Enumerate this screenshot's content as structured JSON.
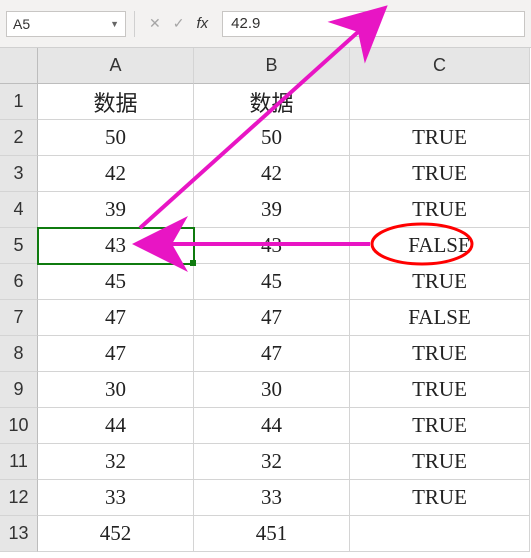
{
  "toolbar": {
    "name_box": "A5",
    "formula_value": "42.9"
  },
  "headers": {
    "col": [
      "A",
      "B",
      "C"
    ],
    "row": [
      "1",
      "2",
      "3",
      "4",
      "5",
      "6",
      "7",
      "8",
      "9",
      "10",
      "11",
      "12",
      "13"
    ]
  },
  "grid": {
    "r1": {
      "A": "数据",
      "B": "数据",
      "C": ""
    },
    "r2": {
      "A": "50",
      "B": "50",
      "C": "TRUE"
    },
    "r3": {
      "A": "42",
      "B": "42",
      "C": "TRUE"
    },
    "r4": {
      "A": "39",
      "B": "39",
      "C": "TRUE"
    },
    "r5": {
      "A": "43",
      "B": "43",
      "C": "FALSE"
    },
    "r6": {
      "A": "45",
      "B": "45",
      "C": "TRUE"
    },
    "r7": {
      "A": "47",
      "B": "47",
      "C": "FALSE"
    },
    "r8": {
      "A": "47",
      "B": "47",
      "C": "TRUE"
    },
    "r9": {
      "A": "30",
      "B": "30",
      "C": "TRUE"
    },
    "r10": {
      "A": "44",
      "B": "44",
      "C": "TRUE"
    },
    "r11": {
      "A": "32",
      "B": "32",
      "C": "TRUE"
    },
    "r12": {
      "A": "33",
      "B": "33",
      "C": "TRUE"
    },
    "r13": {
      "A": "452",
      "B": "451",
      "C": ""
    }
  },
  "selection": "A5"
}
